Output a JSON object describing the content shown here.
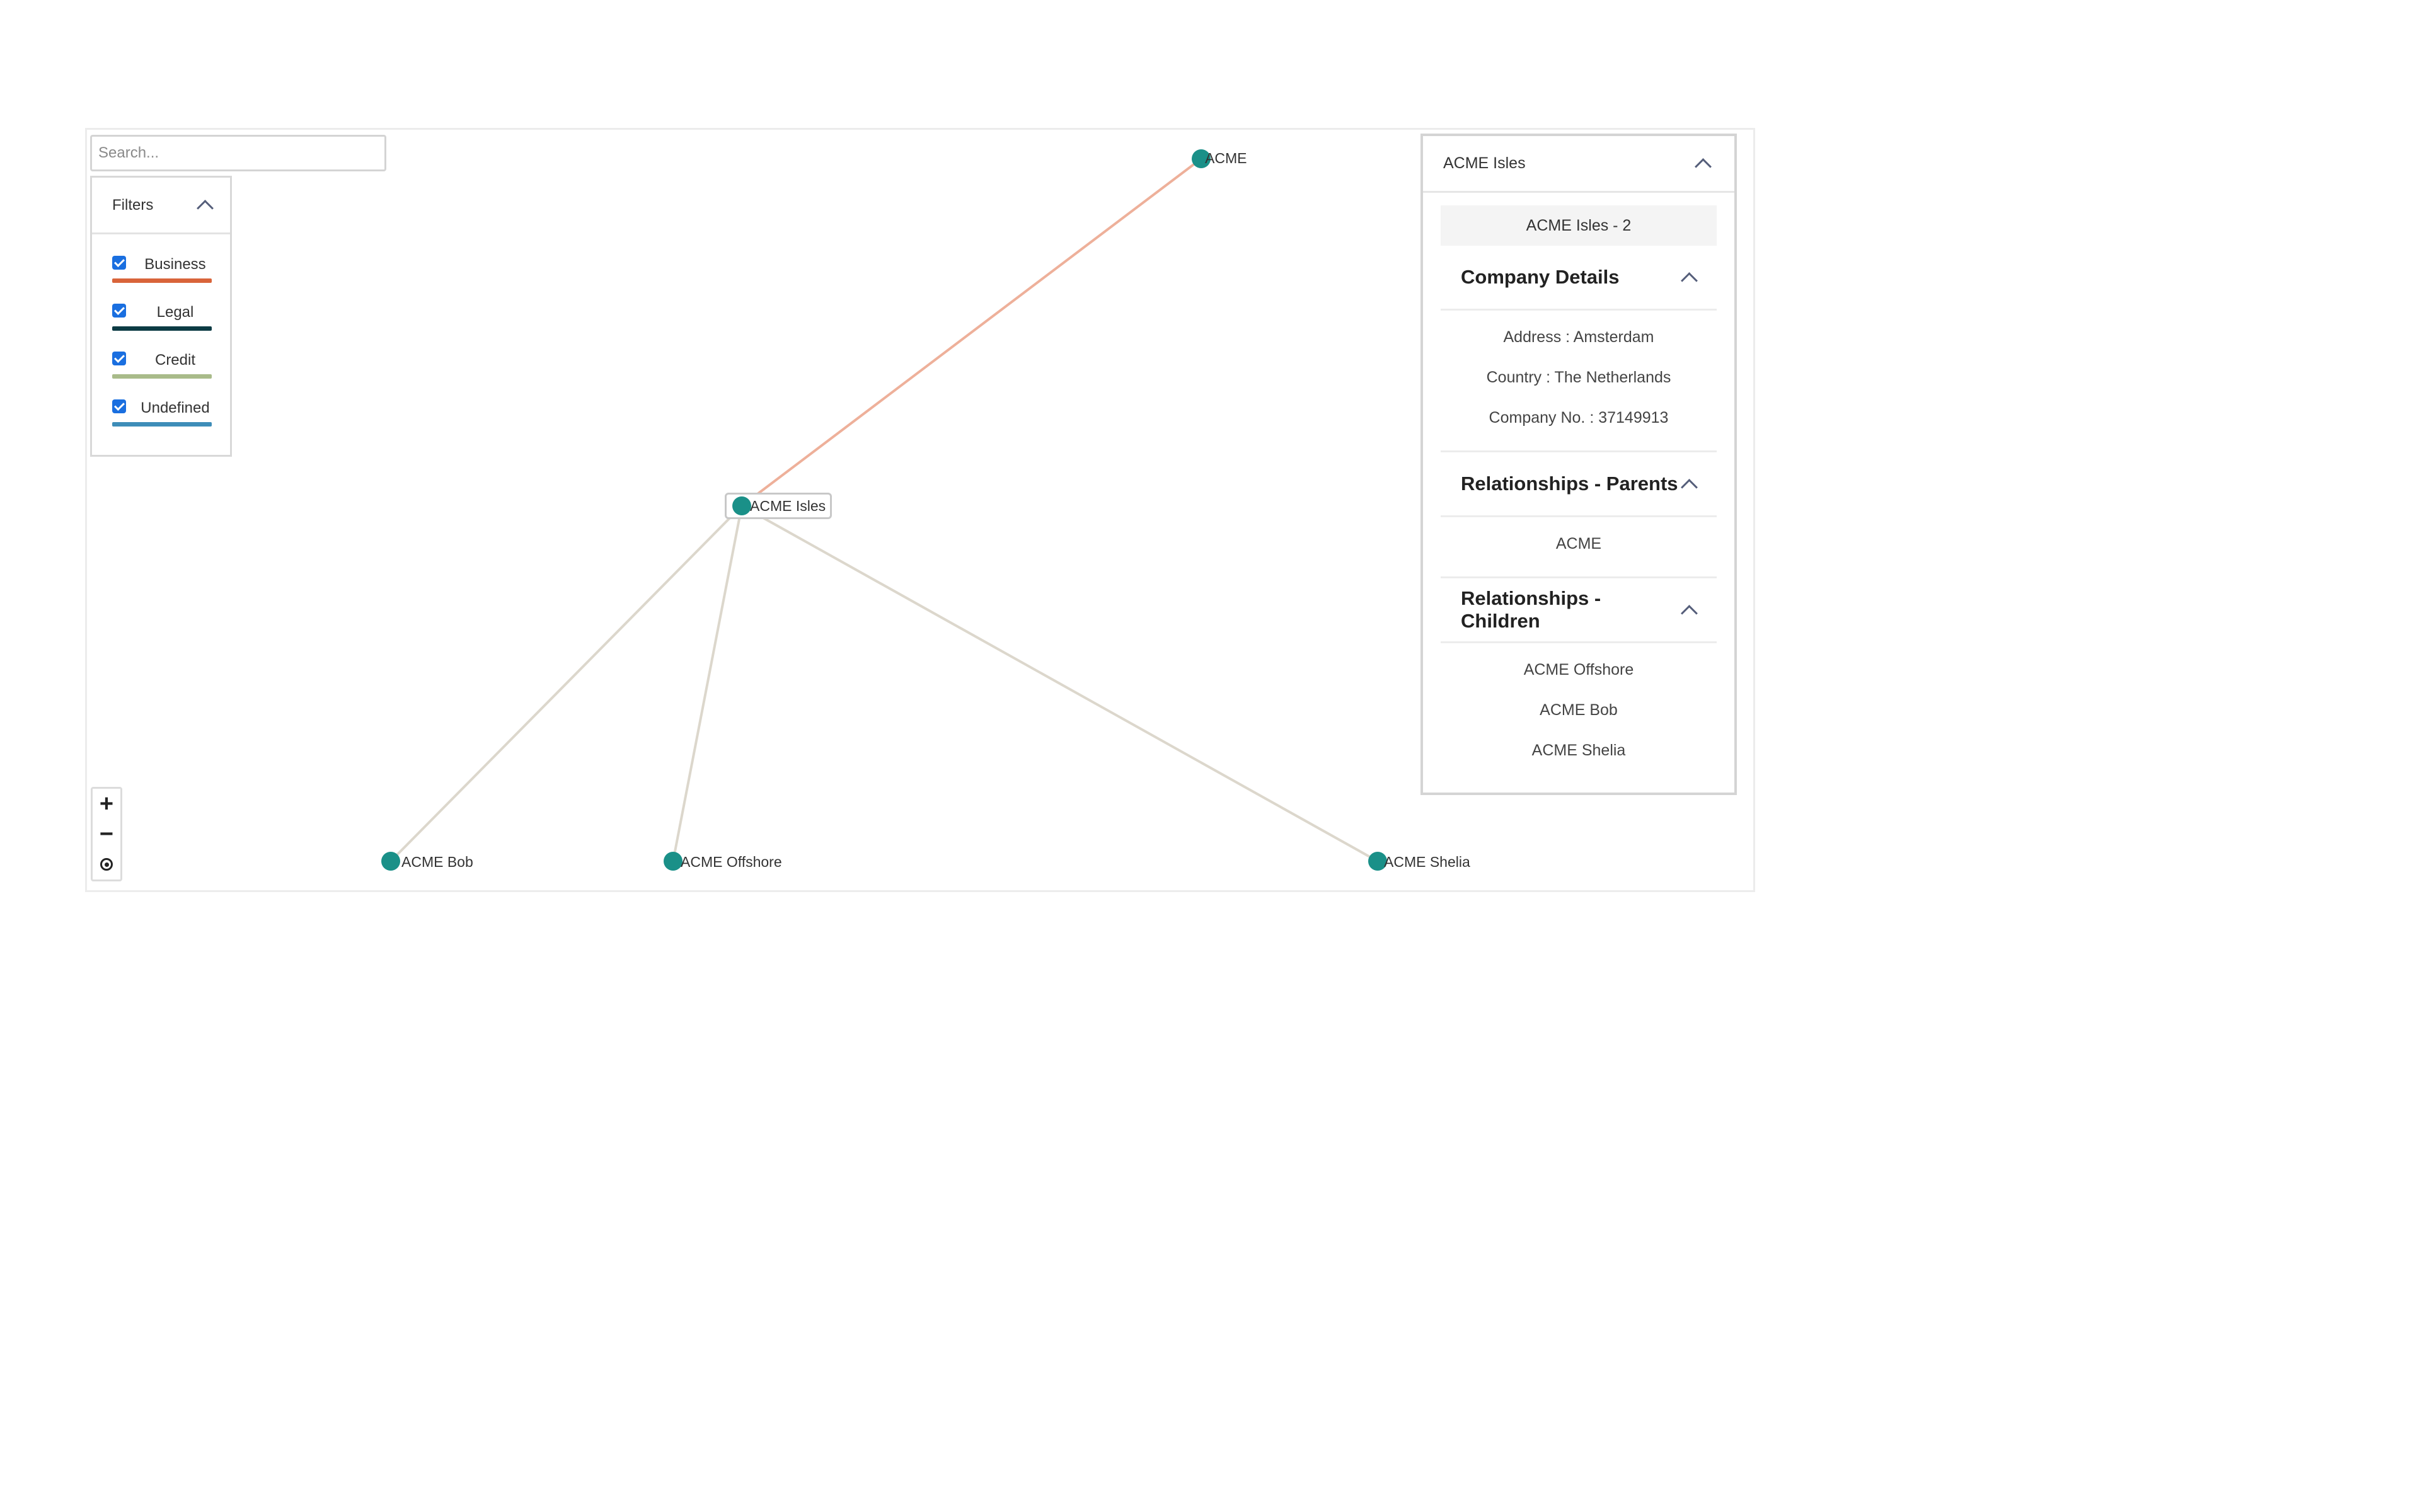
{
  "search": {
    "placeholder": "Search..."
  },
  "filters": {
    "title": "Filters",
    "items": [
      {
        "label": "Business",
        "checked": true,
        "color": "#d9643a"
      },
      {
        "label": "Legal",
        "checked": true,
        "color": "#0c3b44"
      },
      {
        "label": "Credit",
        "checked": true,
        "color": "#a9bb8a"
      },
      {
        "label": "Undefined",
        "checked": true,
        "color": "#3e8db8"
      }
    ]
  },
  "graph": {
    "node_color": "#1a9088",
    "nodes": [
      {
        "label": "ACME"
      },
      {
        "label": "ACME Isles"
      },
      {
        "label": "ACME Bob"
      },
      {
        "label": "ACME Offshore"
      },
      {
        "label": "ACME Shelia"
      }
    ],
    "edge_colors": {
      "business": "#eeb09a",
      "undefined": "#dcd7cc"
    },
    "selected_node": "ACME Isles"
  },
  "zoom": {
    "zoom_in": "+",
    "zoom_out": "−"
  },
  "details": {
    "title": "ACME Isles",
    "entity": "ACME Isles - 2",
    "company_details": {
      "title": "Company Details",
      "items": [
        "Address : Amsterdam",
        "Country : The Netherlands",
        "Company No. : 37149913"
      ]
    },
    "parents": {
      "title": "Relationships - Parents",
      "items": [
        "ACME"
      ]
    },
    "children": {
      "title": "Relationships - Children",
      "items": [
        "ACME Offshore",
        "ACME Bob",
        "ACME Shelia"
      ]
    }
  }
}
